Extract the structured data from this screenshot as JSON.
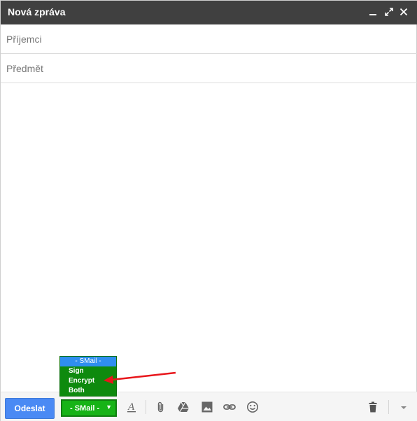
{
  "window": {
    "title": "Nová zpráva"
  },
  "fields": {
    "recipients_placeholder": "Příjemci",
    "subject_placeholder": "Předmět"
  },
  "toolbar": {
    "send_label": "Odeslat",
    "smail_label": "- SMail -",
    "smail_arrow": "▼"
  },
  "smail_dropdown": {
    "options": [
      "- SMail -",
      "Sign",
      "Encrypt",
      "Both"
    ],
    "selected_index": 0
  },
  "icons": {
    "minimize": "minimize-icon",
    "expand": "expand-icon",
    "close": "close-icon",
    "formatting": "text-format-icon",
    "attach": "paperclip-icon",
    "drive": "drive-icon",
    "photo": "photo-icon",
    "link": "link-icon",
    "emoji": "emoji-icon",
    "trash": "trash-icon",
    "more": "more-options-icon"
  },
  "colors": {
    "titlebar": "#404040",
    "send_button": "#4a8af4",
    "smail_button": "#17b317",
    "dropdown_bg": "#0e8a0e",
    "dropdown_selected": "#2f8ef0",
    "annotation_arrow": "#e8161b"
  }
}
